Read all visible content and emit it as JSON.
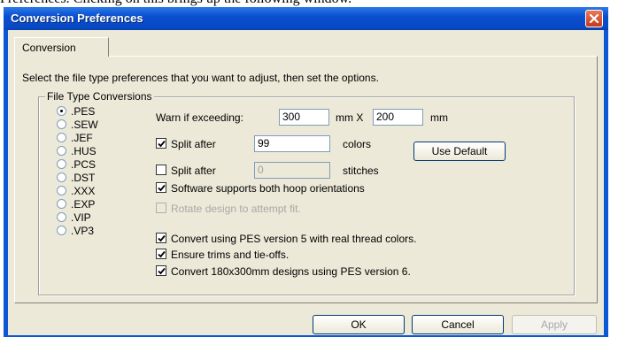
{
  "intro_text": "Preferences. Clicking on this brings up the following window.",
  "window": {
    "title": "Conversion Preferences",
    "close_icon": "close-icon",
    "tab_label": "Conversion",
    "instruction": "Select the file type preferences that you want to adjust, then set the options.",
    "group_label": "File Type Conversions",
    "file_types": [
      {
        "label": ".PES",
        "selected": true
      },
      {
        "label": ".SEW",
        "selected": false
      },
      {
        "label": ".JEF",
        "selected": false
      },
      {
        "label": ".HUS",
        "selected": false
      },
      {
        "label": ".PCS",
        "selected": false
      },
      {
        "label": ".DST",
        "selected": false
      },
      {
        "label": ".XXX",
        "selected": false
      },
      {
        "label": ".EXP",
        "selected": false
      },
      {
        "label": ".VIP",
        "selected": false
      },
      {
        "label": ".VP3",
        "selected": false
      }
    ],
    "warn_label": "Warn if exceeding:",
    "warn_width": "300",
    "warn_mm_x": "mm X",
    "warn_height": "200",
    "warn_mm": "mm",
    "split_colors_label": "Split after",
    "split_colors_value": "99",
    "split_colors_unit": "colors",
    "use_default_label": "Use Default",
    "split_stitches_label": "Split after",
    "split_stitches_value": "0",
    "split_stitches_unit": "stitches",
    "hoop_label": "Software supports both hoop orientations",
    "rotate_label": "Rotate design to attempt fit.",
    "convert_pes5_label": "Convert using PES version 5 with real thread colors.",
    "trims_label": "Ensure trims and tie-offs.",
    "convert_180_label": "Convert 180x300mm designs using PES version 6.",
    "ok_label": "OK",
    "cancel_label": "Cancel",
    "apply_label": "Apply"
  }
}
